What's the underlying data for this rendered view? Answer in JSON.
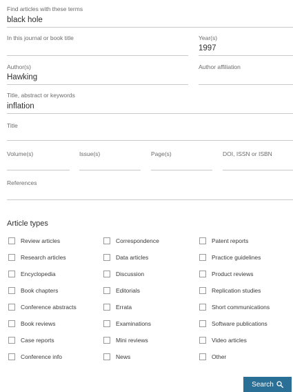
{
  "fields": {
    "terms": {
      "label": "Find articles with these terms",
      "value": "black hole"
    },
    "journal": {
      "label": "In this journal or book title",
      "value": ""
    },
    "year": {
      "label": "Year(s)",
      "value": "1997"
    },
    "author": {
      "label": "Author(s)",
      "value": "Hawking"
    },
    "affiliation": {
      "label": "Author affiliation",
      "value": ""
    },
    "tak": {
      "label": "Title, abstract or keywords",
      "value": "inflation"
    },
    "title": {
      "label": "Title",
      "value": ""
    },
    "volume": {
      "label": "Volume(s)",
      "value": ""
    },
    "issue": {
      "label": "Issue(s)",
      "value": ""
    },
    "pages": {
      "label": "Page(s)",
      "value": ""
    },
    "doi": {
      "label": "DOI, ISSN or ISBN",
      "value": ""
    },
    "references": {
      "label": "References",
      "value": ""
    }
  },
  "article_types": {
    "title": "Article types",
    "col1": [
      "Review articles",
      "Research articles",
      "Encyclopedia",
      "Book chapters",
      "Conference abstracts",
      "Book reviews",
      "Case reports",
      "Conference info"
    ],
    "col2": [
      "Correspondence",
      "Data articles",
      "Discussion",
      "Editorials",
      "Errata",
      "Examinations",
      "Mini reviews",
      "News"
    ],
    "col3": [
      "Patent reports",
      "Practice guidelines",
      "Product reviews",
      "Replication studies",
      "Short communications",
      "Software publications",
      "Video articles",
      "Other"
    ]
  },
  "search_button": {
    "label": "Search",
    "icon": "search-icon"
  }
}
